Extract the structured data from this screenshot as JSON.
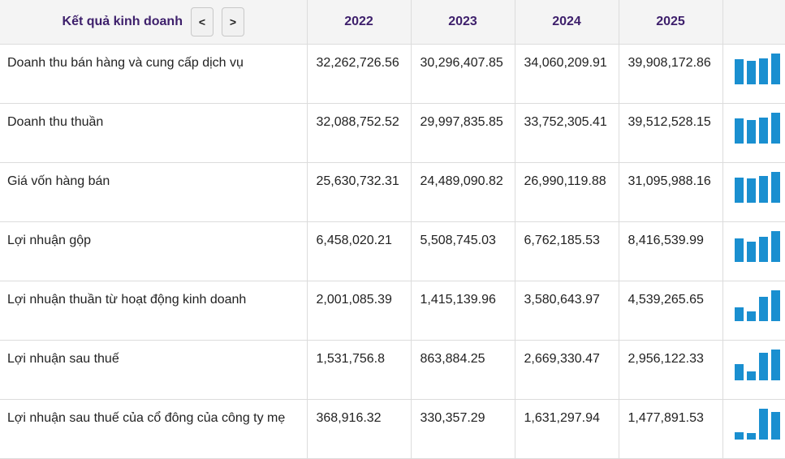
{
  "header": {
    "title": "Kết quả kinh doanh",
    "prev_label": "<",
    "next_label": ">",
    "years": [
      "2022",
      "2023",
      "2024",
      "2025"
    ]
  },
  "rows": [
    {
      "label": "Doanh thu bán hàng và cung cấp dịch vụ",
      "values": [
        "32,262,726.56",
        "30,296,407.85",
        "34,060,209.91",
        "39,908,172.86"
      ],
      "spark": [
        32262726.56,
        30296407.85,
        34060209.91,
        39908172.86
      ]
    },
    {
      "label": "Doanh thu thuần",
      "values": [
        "32,088,752.52",
        "29,997,835.85",
        "33,752,305.41",
        "39,512,528.15"
      ],
      "spark": [
        32088752.52,
        29997835.85,
        33752305.41,
        39512528.15
      ]
    },
    {
      "label": "Giá vốn hàng bán",
      "values": [
        "25,630,732.31",
        "24,489,090.82",
        "26,990,119.88",
        "31,095,988.16"
      ],
      "spark": [
        25630732.31,
        24489090.82,
        26990119.88,
        31095988.16
      ]
    },
    {
      "label": "Lợi nhuận gộp",
      "values": [
        "6,458,020.21",
        "5,508,745.03",
        "6,762,185.53",
        "8,416,539.99"
      ],
      "spark": [
        6458020.21,
        5508745.03,
        6762185.53,
        8416539.99
      ]
    },
    {
      "label": "Lợi nhuận thuần từ hoạt động kinh doanh",
      "values": [
        "2,001,085.39",
        "1,415,139.96",
        "3,580,643.97",
        "4,539,265.65"
      ],
      "spark": [
        2001085.39,
        1415139.96,
        3580643.97,
        4539265.65
      ]
    },
    {
      "label": "Lợi nhuận sau thuế",
      "values": [
        "1,531,756.8",
        "863,884.25",
        "2,669,330.47",
        "2,956,122.33"
      ],
      "spark": [
        1531756.8,
        863884.25,
        2669330.47,
        2956122.33
      ]
    },
    {
      "label": "Lợi nhuận sau thuế của cổ đông của công ty mẹ",
      "values": [
        "368,916.32",
        "330,357.29",
        "1,631,297.94",
        "1,477,891.53"
      ],
      "spark": [
        368916.32,
        330357.29,
        1631297.94,
        1477891.53
      ]
    }
  ],
  "colors": {
    "spark_bar": "#1a8fd0",
    "header_text": "#3d1f6b"
  }
}
